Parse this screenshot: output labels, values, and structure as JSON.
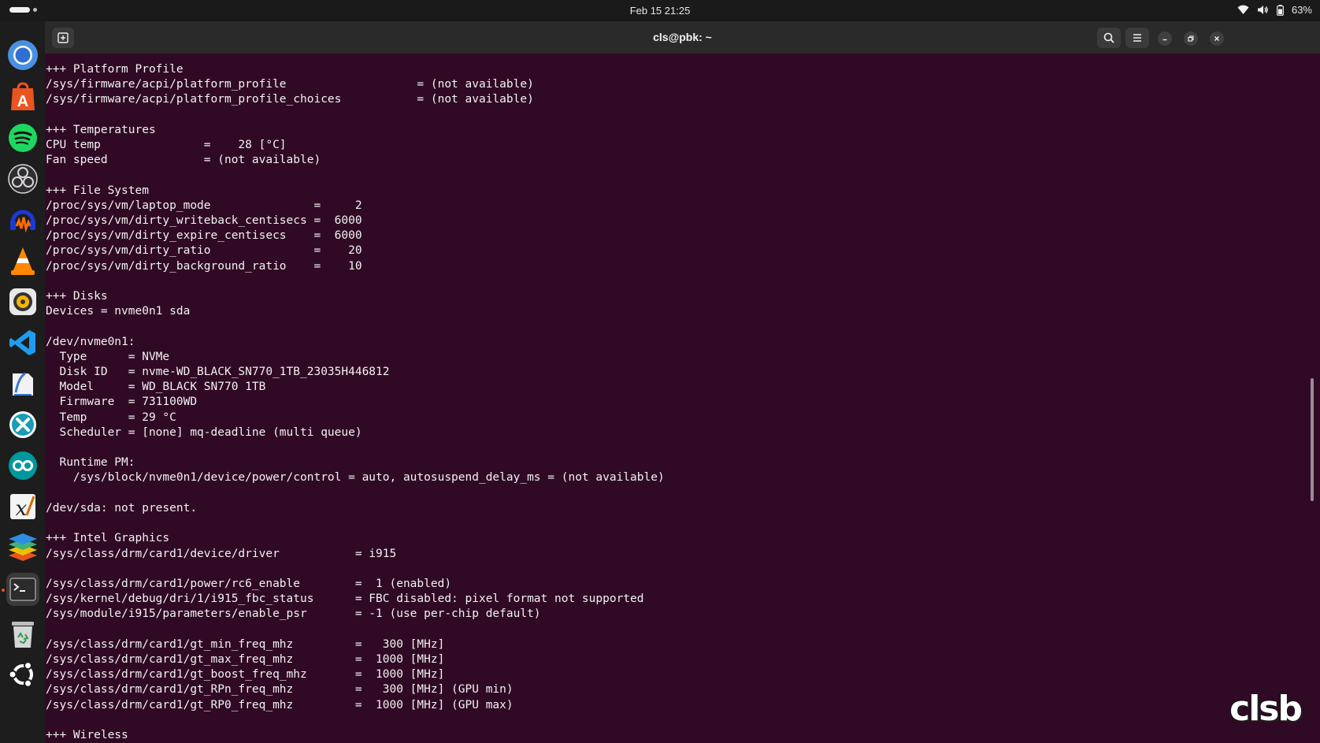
{
  "topbar": {
    "datetime": "Feb 15  21:25",
    "battery_percent": "63%"
  },
  "dock": {
    "apps": [
      {
        "name": "chromium-icon"
      },
      {
        "name": "app-center-icon"
      },
      {
        "name": "spotify-icon"
      },
      {
        "name": "obs-studio-icon"
      },
      {
        "name": "audacity-icon"
      },
      {
        "name": "vlc-icon"
      },
      {
        "name": "rhythmbox-icon"
      },
      {
        "name": "vscode-icon"
      },
      {
        "name": "writer-icon"
      },
      {
        "name": "xodo-icon"
      },
      {
        "name": "arduino-icon"
      },
      {
        "name": "xournal-icon"
      },
      {
        "name": "layers-icon"
      },
      {
        "name": "terminal-icon",
        "active": true
      },
      {
        "name": "trash-icon"
      },
      {
        "name": "ubuntu-icon"
      }
    ]
  },
  "terminal": {
    "title": "cls@pbk: ~",
    "lines": [
      "+++ Platform Profile",
      "/sys/firmware/acpi/platform_profile                   = (not available)",
      "/sys/firmware/acpi/platform_profile_choices           = (not available)",
      "",
      "+++ Temperatures",
      "CPU temp               =    28 [°C]",
      "Fan speed              = (not available)",
      "",
      "+++ File System",
      "/proc/sys/vm/laptop_mode               =     2",
      "/proc/sys/vm/dirty_writeback_centisecs =  6000",
      "/proc/sys/vm/dirty_expire_centisecs    =  6000",
      "/proc/sys/vm/dirty_ratio               =    20",
      "/proc/sys/vm/dirty_background_ratio    =    10",
      "",
      "+++ Disks",
      "Devices = nvme0n1 sda",
      "",
      "/dev/nvme0n1:",
      "  Type      = NVMe",
      "  Disk ID   = nvme-WD_BLACK_SN770_1TB_23035H446812",
      "  Model     = WD_BLACK SN770 1TB",
      "  Firmware  = 731100WD",
      "  Temp      = 29 °C",
      "  Scheduler = [none] mq-deadline (multi queue)",
      "",
      "  Runtime PM:",
      "    /sys/block/nvme0n1/device/power/control = auto, autosuspend_delay_ms = (not available)",
      "",
      "/dev/sda: not present.",
      "",
      "+++ Intel Graphics",
      "/sys/class/drm/card1/device/driver           = i915",
      "",
      "/sys/class/drm/card1/power/rc6_enable        =  1 (enabled)",
      "/sys/kernel/debug/dri/1/i915_fbc_status      = FBC disabled: pixel format not supported",
      "/sys/module/i915/parameters/enable_psr       = -1 (use per-chip default)",
      "",
      "/sys/class/drm/card1/gt_min_freq_mhz         =   300 [MHz]",
      "/sys/class/drm/card1/gt_max_freq_mhz         =  1000 [MHz]",
      "/sys/class/drm/card1/gt_boost_freq_mhz       =  1000 [MHz]",
      "/sys/class/drm/card1/gt_RPn_freq_mhz         =   300 [MHz] (GPU min)",
      "/sys/class/drm/card1/gt_RP0_freq_mhz         =  1000 [MHz] (GPU max)",
      "",
      "+++ Wireless"
    ]
  },
  "watermark": "clsb",
  "colors": {
    "terminal_bg": "#300a24",
    "topbar_bg": "#1a1a1a",
    "dock_bg": "#1d1d1d",
    "accent": "#e95420"
  }
}
